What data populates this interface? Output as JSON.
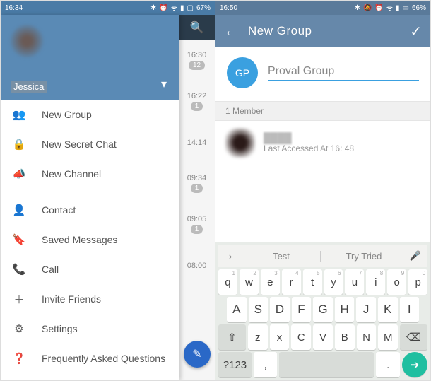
{
  "left": {
    "status": {
      "time": "16:34",
      "battery": "67%"
    },
    "drawer": {
      "name": "Jessica",
      "items": [
        {
          "icon": "👥",
          "label": "New Group"
        },
        {
          "icon": "🔒",
          "label": "New Secret Chat"
        },
        {
          "icon": "📣",
          "label": "New Channel"
        }
      ],
      "items2": [
        {
          "icon": "👤",
          "label": "Contact"
        },
        {
          "icon": "🔖",
          "label": "Saved Messages"
        },
        {
          "icon": "📞",
          "label": "Call"
        },
        {
          "icon": "＋",
          "label": "Invite Friends"
        },
        {
          "icon": "⚙",
          "label": "Settings"
        },
        {
          "icon": "❓",
          "label": "Frequently Asked Questions"
        }
      ]
    },
    "strip": [
      {
        "time": "16:30",
        "badge": "12"
      },
      {
        "time": "16:22",
        "badge": "1"
      },
      {
        "time": "14:14",
        "badge": ""
      },
      {
        "time": "09:34",
        "badge": "1"
      },
      {
        "time": "09:05",
        "badge": "1"
      },
      {
        "time": "08:00",
        "badge": ""
      }
    ]
  },
  "right": {
    "status": {
      "time": "16:50",
      "battery": "66%"
    },
    "appbar": {
      "title": "New Group"
    },
    "group": {
      "avatar_initials": "GP",
      "name_value": "Proval Group"
    },
    "members": {
      "header": "1 Member",
      "first": {
        "status": "Last Accessed At 16: 48"
      }
    },
    "keyboard": {
      "suggestions": [
        "Test",
        "Try Tried"
      ],
      "row1": [
        "q",
        "w",
        "e",
        "r",
        "t",
        "y",
        "u",
        "i",
        "o",
        "p"
      ],
      "row1_sup": [
        "1",
        "2",
        "3",
        "4",
        "5",
        "6",
        "7",
        "8",
        "9",
        "0"
      ],
      "row2": [
        "A",
        "S",
        "D",
        "F",
        "G",
        "H",
        "J",
        "K",
        "I"
      ],
      "row3_shift": "⇧",
      "row3": [
        "z",
        "x",
        "C",
        "V",
        "B",
        "N",
        "M"
      ],
      "row3_bksp": "⌫",
      "row4": {
        "sym": "?123",
        "comma": ",",
        "period": ".",
        "enter": "➔"
      }
    }
  }
}
